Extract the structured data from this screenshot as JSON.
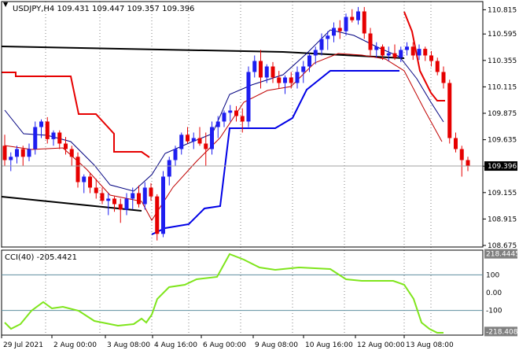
{
  "header": {
    "main_title": "USDJPY,H4  109.431 109.447 109.357 109.396",
    "indicator_title": "CCI(40) -205.4421"
  },
  "colors": {
    "bull": "#1e1ef0",
    "bear": "#e60000",
    "black_line": "#000000",
    "red_line": "#e60000",
    "blue_line": "#0000e6",
    "navy_line": "#000080",
    "darkred_line": "#c00000",
    "cci_line": "#7fe51c",
    "grid": "#808080",
    "level": "#5f8fa0"
  },
  "price_axis": {
    "min": 108.675,
    "max": 110.875,
    "ticks": [
      "110.815",
      "110.595",
      "110.355",
      "110.115",
      "109.875",
      "109.635",
      "109.395",
      "109.155",
      "108.915",
      "108.675"
    ],
    "current_label": "109.396",
    "current_value": 109.396
  },
  "cci_axis": {
    "min": -230,
    "max": 230,
    "ticks": [
      {
        "label": "218.4445",
        "value": 218.4445
      },
      {
        "label": "100",
        "value": 100
      },
      {
        "label": "0.00",
        "value": 0
      },
      {
        "label": "-100",
        "value": -100
      },
      {
        "label": "-218.4082",
        "value": -218.4082
      }
    ]
  },
  "time_axis": [
    "29 Jul 2021",
    "2 Aug 00:00",
    "3 Aug 08:00",
    "4 Aug 16:00",
    "6 Aug 00:00",
    "9 Aug 08:00",
    "10 Aug 16:00",
    "12 Aug 00:00",
    "13 Aug 08:00"
  ],
  "chart_data": {
    "type": "candlestick",
    "candles": [
      [
        109.58,
        109.68,
        109.4,
        109.45
      ],
      [
        109.45,
        109.52,
        109.35,
        109.48
      ],
      [
        109.48,
        109.58,
        109.42,
        109.55
      ],
      [
        109.55,
        109.58,
        109.4,
        109.48
      ],
      [
        109.48,
        109.6,
        109.44,
        109.55
      ],
      [
        109.55,
        109.8,
        109.5,
        109.75
      ],
      [
        109.75,
        109.82,
        109.65,
        109.8
      ],
      [
        109.8,
        109.84,
        109.6,
        109.64
      ],
      [
        109.64,
        109.72,
        109.58,
        109.7
      ],
      [
        109.7,
        109.72,
        109.55,
        109.6
      ],
      [
        109.6,
        109.66,
        109.5,
        109.55
      ],
      [
        109.55,
        109.58,
        109.4,
        109.48
      ],
      [
        109.48,
        109.52,
        109.2,
        109.25
      ],
      [
        109.25,
        109.32,
        109.15,
        109.3
      ],
      [
        109.3,
        109.33,
        109.15,
        109.2
      ],
      [
        109.2,
        109.28,
        109.1,
        109.15
      ],
      [
        109.15,
        109.2,
        109.05,
        109.08
      ],
      [
        109.08,
        109.15,
        108.95,
        109.1
      ],
      [
        109.1,
        109.12,
        108.98,
        109.05
      ],
      [
        109.05,
        109.1,
        108.88,
        109.0
      ],
      [
        109.0,
        109.15,
        108.95,
        109.1
      ],
      [
        109.1,
        109.2,
        109.0,
        109.15
      ],
      [
        109.15,
        109.22,
        109.02,
        109.05
      ],
      [
        109.05,
        109.25,
        109.0,
        109.2
      ],
      [
        109.2,
        109.24,
        109.08,
        109.12
      ],
      [
        109.12,
        109.14,
        108.72,
        108.78
      ],
      [
        108.78,
        109.35,
        108.75,
        109.3
      ],
      [
        109.3,
        109.48,
        109.22,
        109.45
      ],
      [
        109.45,
        109.58,
        109.4,
        109.55
      ],
      [
        109.55,
        109.7,
        109.5,
        109.68
      ],
      [
        109.68,
        109.75,
        109.6,
        109.62
      ],
      [
        109.62,
        109.7,
        109.55,
        109.65
      ],
      [
        109.65,
        109.75,
        109.58,
        109.6
      ],
      [
        109.6,
        109.7,
        109.4,
        109.55
      ],
      [
        109.55,
        109.8,
        109.5,
        109.75
      ],
      [
        109.75,
        109.85,
        109.65,
        109.8
      ],
      [
        109.8,
        109.9,
        109.75,
        109.88
      ],
      [
        109.88,
        109.95,
        109.8,
        109.9
      ],
      [
        109.9,
        109.94,
        109.8,
        109.85
      ],
      [
        109.85,
        109.92,
        109.7,
        109.8
      ],
      [
        109.8,
        110.3,
        109.75,
        110.25
      ],
      [
        110.25,
        110.4,
        110.2,
        110.35
      ],
      [
        110.35,
        110.45,
        110.1,
        110.2
      ],
      [
        110.2,
        110.32,
        110.15,
        110.3
      ],
      [
        110.3,
        110.34,
        110.15,
        110.2
      ],
      [
        110.2,
        110.26,
        110.1,
        110.15
      ],
      [
        110.15,
        110.22,
        110.05,
        110.2
      ],
      [
        110.2,
        110.25,
        110.1,
        110.15
      ],
      [
        110.15,
        110.3,
        110.1,
        110.25
      ],
      [
        110.25,
        110.35,
        110.15,
        110.3
      ],
      [
        110.3,
        110.42,
        110.25,
        110.4
      ],
      [
        110.4,
        110.48,
        110.32,
        110.45
      ],
      [
        110.45,
        110.6,
        110.4,
        110.55
      ],
      [
        110.55,
        110.62,
        110.45,
        110.58
      ],
      [
        110.58,
        110.7,
        110.52,
        110.65
      ],
      [
        110.65,
        110.72,
        110.55,
        110.62
      ],
      [
        110.62,
        110.78,
        110.58,
        110.75
      ],
      [
        110.75,
        110.82,
        110.7,
        110.72
      ],
      [
        110.72,
        110.84,
        110.68,
        110.8
      ],
      [
        110.8,
        110.84,
        110.55,
        110.6
      ],
      [
        110.6,
        110.65,
        110.4,
        110.45
      ],
      [
        110.45,
        110.52,
        110.38,
        110.48
      ],
      [
        110.48,
        110.5,
        110.36,
        110.4
      ],
      [
        110.4,
        110.48,
        110.35,
        110.42
      ],
      [
        110.42,
        110.5,
        110.36,
        110.38
      ],
      [
        110.38,
        110.48,
        110.34,
        110.45
      ],
      [
        110.45,
        110.52,
        110.4,
        110.48
      ],
      [
        110.48,
        110.52,
        110.36,
        110.4
      ],
      [
        110.4,
        110.5,
        110.36,
        110.46
      ],
      [
        110.46,
        110.48,
        110.35,
        110.4
      ],
      [
        110.4,
        110.44,
        110.3,
        110.35
      ],
      [
        110.35,
        110.38,
        110.22,
        110.25
      ],
      [
        110.25,
        110.3,
        110.1,
        110.15
      ],
      [
        110.15,
        110.18,
        109.6,
        109.65
      ],
      [
        109.65,
        109.7,
        109.52,
        109.55
      ],
      [
        109.55,
        109.58,
        109.3,
        109.45
      ],
      [
        109.45,
        109.48,
        109.35,
        109.4
      ]
    ]
  }
}
